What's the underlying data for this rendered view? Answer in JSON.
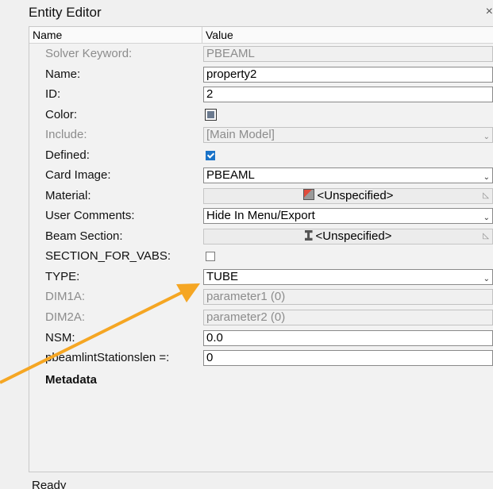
{
  "window": {
    "title": "Entity Editor",
    "close_icon": "close-icon",
    "close_glyph": "×"
  },
  "table": {
    "header_name": "Name",
    "header_value": "Value"
  },
  "rows": {
    "solver_keyword": {
      "label": "Solver Keyword:",
      "value": "PBEAML"
    },
    "name": {
      "label": "Name:",
      "value": "property2"
    },
    "id": {
      "label": "ID:",
      "value": "2"
    },
    "color": {
      "label": "Color:",
      "swatch": "#6b7a8f"
    },
    "include": {
      "label": "Include:",
      "value": "[Main Model]"
    },
    "defined": {
      "label": "Defined:",
      "checked": true
    },
    "card_image": {
      "label": "Card Image:",
      "value": "PBEAML"
    },
    "material": {
      "label": "Material:",
      "value": "<Unspecified>",
      "icon": "material-icon"
    },
    "user_comments": {
      "label": "User Comments:",
      "value": "Hide In Menu/Export"
    },
    "beam_section": {
      "label": "Beam Section:",
      "value": "<Unspecified>",
      "icon": "beam-section-icon"
    },
    "section_for_vabs": {
      "label": "SECTION_FOR_VABS:",
      "checked": false
    },
    "type": {
      "label": "TYPE:",
      "value": "TUBE"
    },
    "dim1a": {
      "label": "DIM1A:",
      "value": "parameter1 (0)"
    },
    "dim2a": {
      "label": "DIM2A:",
      "value": "parameter2 (0)"
    },
    "nsm": {
      "label": "NSM:",
      "value": "0.0"
    },
    "pbeamlint": {
      "label": "pbeamlintStationslen =:",
      "value": "0"
    },
    "metadata": {
      "label": "Metadata"
    }
  },
  "status": "Ready",
  "annotation": {
    "arrow_color": "#f5a623"
  },
  "glyphs": {
    "chevron": "⌄",
    "corner": "◺"
  }
}
